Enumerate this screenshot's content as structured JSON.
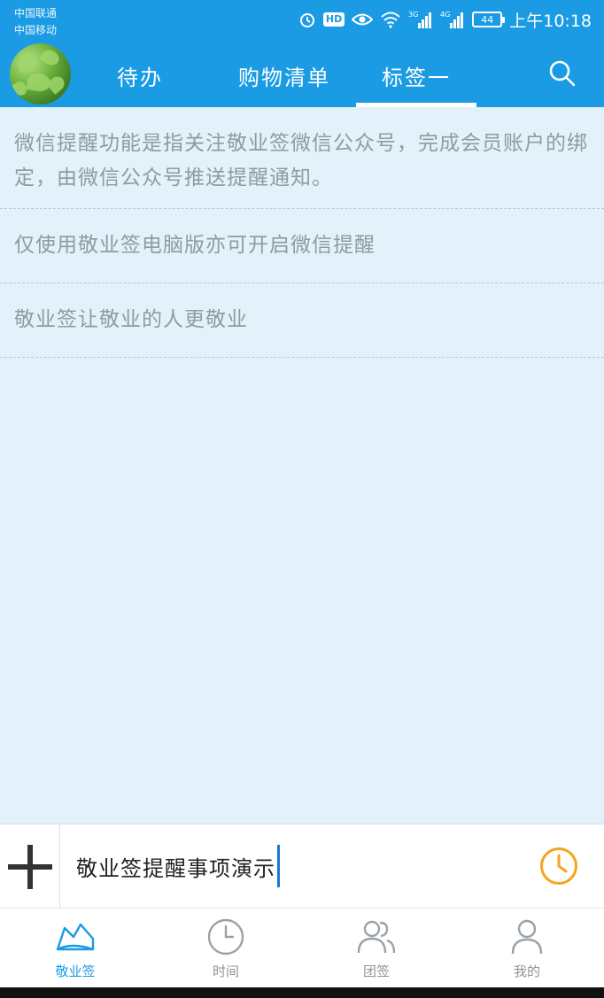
{
  "status_bar": {
    "carrier1": "中国联通",
    "carrier2": "中国移动",
    "hd": "HD",
    "net1": "3G",
    "net2": "4G",
    "battery": "44",
    "time": "上午10:18"
  },
  "header": {
    "tabs": [
      {
        "label": "待办"
      },
      {
        "label": "购物清单"
      },
      {
        "label": "标签一"
      }
    ],
    "active_tab_index": 2,
    "accent_color": "#1a9be3"
  },
  "list": {
    "items": [
      {
        "text": "微信提醒功能是指关注敬业签微信公众号，完成会员账户的绑定，由微信公众号推送提醒通知。"
      },
      {
        "text": "仅使用敬业签电脑版亦可开启微信提醒"
      },
      {
        "text": "敬业签让敬业的人更敬业"
      }
    ]
  },
  "input_bar": {
    "value": "敬业签提醒事项演示",
    "add_icon": "plus-icon",
    "timer_icon": "clock-icon"
  },
  "bottom_nav": {
    "items": [
      {
        "label": "敬业签",
        "icon": "note-icon"
      },
      {
        "label": "时间",
        "icon": "clock-icon"
      },
      {
        "label": "团签",
        "icon": "group-icon"
      },
      {
        "label": "我的",
        "icon": "user-icon"
      }
    ],
    "active_index": 0
  }
}
